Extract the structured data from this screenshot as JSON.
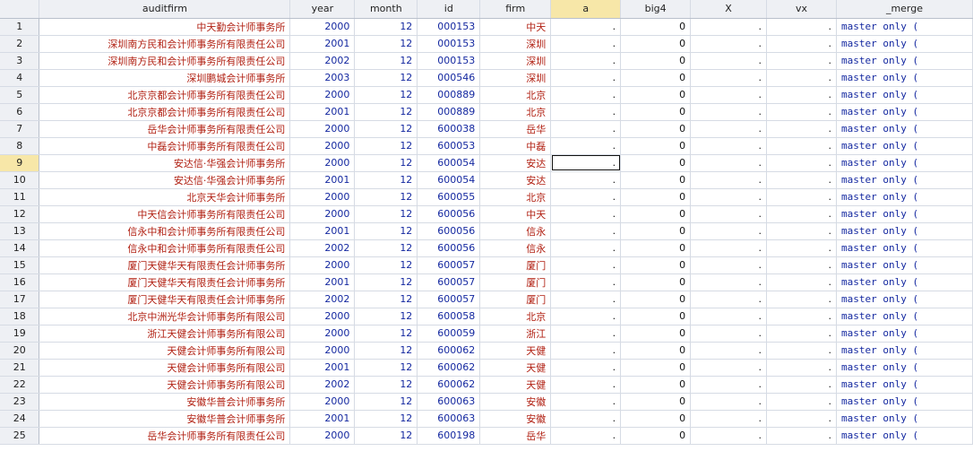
{
  "columns": [
    "auditfirm",
    "year",
    "month",
    "id",
    "firm",
    "a",
    "big4",
    "X",
    "vx",
    "_merge"
  ],
  "selection": {
    "row": "9",
    "column": "a"
  },
  "rows": [
    {
      "n": "1",
      "auditfirm": "中天勤会计师事务所",
      "year": "2000",
      "month": "12",
      "id": "000153",
      "firm": "中天",
      "a": ".",
      "big4": "0",
      "X": ".",
      "vx": ".",
      "_merge": "master only ("
    },
    {
      "n": "2",
      "auditfirm": "深圳南方民和会计师事务所有限责任公司",
      "year": "2001",
      "month": "12",
      "id": "000153",
      "firm": "深圳",
      "a": ".",
      "big4": "0",
      "X": ".",
      "vx": ".",
      "_merge": "master only ("
    },
    {
      "n": "3",
      "auditfirm": "深圳南方民和会计师事务所有限责任公司",
      "year": "2002",
      "month": "12",
      "id": "000153",
      "firm": "深圳",
      "a": ".",
      "big4": "0",
      "X": ".",
      "vx": ".",
      "_merge": "master only ("
    },
    {
      "n": "4",
      "auditfirm": "深圳鹏城会计师事务所",
      "year": "2003",
      "month": "12",
      "id": "000546",
      "firm": "深圳",
      "a": ".",
      "big4": "0",
      "X": ".",
      "vx": ".",
      "_merge": "master only ("
    },
    {
      "n": "5",
      "auditfirm": "北京京都会计师事务所有限责任公司",
      "year": "2000",
      "month": "12",
      "id": "000889",
      "firm": "北京",
      "a": ".",
      "big4": "0",
      "X": ".",
      "vx": ".",
      "_merge": "master only ("
    },
    {
      "n": "6",
      "auditfirm": "北京京都会计师事务所有限责任公司",
      "year": "2001",
      "month": "12",
      "id": "000889",
      "firm": "北京",
      "a": ".",
      "big4": "0",
      "X": ".",
      "vx": ".",
      "_merge": "master only ("
    },
    {
      "n": "7",
      "auditfirm": "岳华会计师事务所有限责任公司",
      "year": "2000",
      "month": "12",
      "id": "600038",
      "firm": "岳华",
      "a": ".",
      "big4": "0",
      "X": ".",
      "vx": ".",
      "_merge": "master only ("
    },
    {
      "n": "8",
      "auditfirm": "中磊会计师事务所有限责任公司",
      "year": "2000",
      "month": "12",
      "id": "600053",
      "firm": "中磊",
      "a": ".",
      "big4": "0",
      "X": ".",
      "vx": ".",
      "_merge": "master only ("
    },
    {
      "n": "9",
      "auditfirm": "安达信·华强会计师事务所",
      "year": "2000",
      "month": "12",
      "id": "600054",
      "firm": "安达",
      "a": ".",
      "big4": "0",
      "X": ".",
      "vx": ".",
      "_merge": "master only ("
    },
    {
      "n": "10",
      "auditfirm": "安达信·华强会计师事务所",
      "year": "2001",
      "month": "12",
      "id": "600054",
      "firm": "安达",
      "a": ".",
      "big4": "0",
      "X": ".",
      "vx": ".",
      "_merge": "master only ("
    },
    {
      "n": "11",
      "auditfirm": "北京天华会计师事务所",
      "year": "2000",
      "month": "12",
      "id": "600055",
      "firm": "北京",
      "a": ".",
      "big4": "0",
      "X": ".",
      "vx": ".",
      "_merge": "master only ("
    },
    {
      "n": "12",
      "auditfirm": "中天信会计师事务所有限责任公司",
      "year": "2000",
      "month": "12",
      "id": "600056",
      "firm": "中天",
      "a": ".",
      "big4": "0",
      "X": ".",
      "vx": ".",
      "_merge": "master only ("
    },
    {
      "n": "13",
      "auditfirm": "信永中和会计师事务所有限责任公司",
      "year": "2001",
      "month": "12",
      "id": "600056",
      "firm": "信永",
      "a": ".",
      "big4": "0",
      "X": ".",
      "vx": ".",
      "_merge": "master only ("
    },
    {
      "n": "14",
      "auditfirm": "信永中和会计师事务所有限责任公司",
      "year": "2002",
      "month": "12",
      "id": "600056",
      "firm": "信永",
      "a": ".",
      "big4": "0",
      "X": ".",
      "vx": ".",
      "_merge": "master only ("
    },
    {
      "n": "15",
      "auditfirm": "厦门天健华天有限责任会计师事务所",
      "year": "2000",
      "month": "12",
      "id": "600057",
      "firm": "厦门",
      "a": ".",
      "big4": "0",
      "X": ".",
      "vx": ".",
      "_merge": "master only ("
    },
    {
      "n": "16",
      "auditfirm": "厦门天健华天有限责任会计师事务所",
      "year": "2001",
      "month": "12",
      "id": "600057",
      "firm": "厦门",
      "a": ".",
      "big4": "0",
      "X": ".",
      "vx": ".",
      "_merge": "master only ("
    },
    {
      "n": "17",
      "auditfirm": "厦门天健华天有限责任会计师事务所",
      "year": "2002",
      "month": "12",
      "id": "600057",
      "firm": "厦门",
      "a": ".",
      "big4": "0",
      "X": ".",
      "vx": ".",
      "_merge": "master only ("
    },
    {
      "n": "18",
      "auditfirm": "北京中洲光华会计师事务所有限公司",
      "year": "2000",
      "month": "12",
      "id": "600058",
      "firm": "北京",
      "a": ".",
      "big4": "0",
      "X": ".",
      "vx": ".",
      "_merge": "master only ("
    },
    {
      "n": "19",
      "auditfirm": "浙江天健会计师事务所有限公司",
      "year": "2000",
      "month": "12",
      "id": "600059",
      "firm": "浙江",
      "a": ".",
      "big4": "0",
      "X": ".",
      "vx": ".",
      "_merge": "master only ("
    },
    {
      "n": "20",
      "auditfirm": "天健会计师事务所有限公司",
      "year": "2000",
      "month": "12",
      "id": "600062",
      "firm": "天健",
      "a": ".",
      "big4": "0",
      "X": ".",
      "vx": ".",
      "_merge": "master only ("
    },
    {
      "n": "21",
      "auditfirm": "天健会计师事务所有限公司",
      "year": "2001",
      "month": "12",
      "id": "600062",
      "firm": "天健",
      "a": ".",
      "big4": "0",
      "X": ".",
      "vx": ".",
      "_merge": "master only ("
    },
    {
      "n": "22",
      "auditfirm": "天健会计师事务所有限公司",
      "year": "2002",
      "month": "12",
      "id": "600062",
      "firm": "天健",
      "a": ".",
      "big4": "0",
      "X": ".",
      "vx": ".",
      "_merge": "master only ("
    },
    {
      "n": "23",
      "auditfirm": "安徽华普会计师事务所",
      "year": "2000",
      "month": "12",
      "id": "600063",
      "firm": "安徽",
      "a": ".",
      "big4": "0",
      "X": ".",
      "vx": ".",
      "_merge": "master only ("
    },
    {
      "n": "24",
      "auditfirm": "安徽华普会计师事务所",
      "year": "2001",
      "month": "12",
      "id": "600063",
      "firm": "安徽",
      "a": ".",
      "big4": "0",
      "X": ".",
      "vx": ".",
      "_merge": "master only ("
    },
    {
      "n": "25",
      "auditfirm": "岳华会计师事务所有限责任公司",
      "year": "2000",
      "month": "12",
      "id": "600198",
      "firm": "岳华",
      "a": ".",
      "big4": "0",
      "X": ".",
      "vx": ".",
      "_merge": "master only ("
    }
  ]
}
